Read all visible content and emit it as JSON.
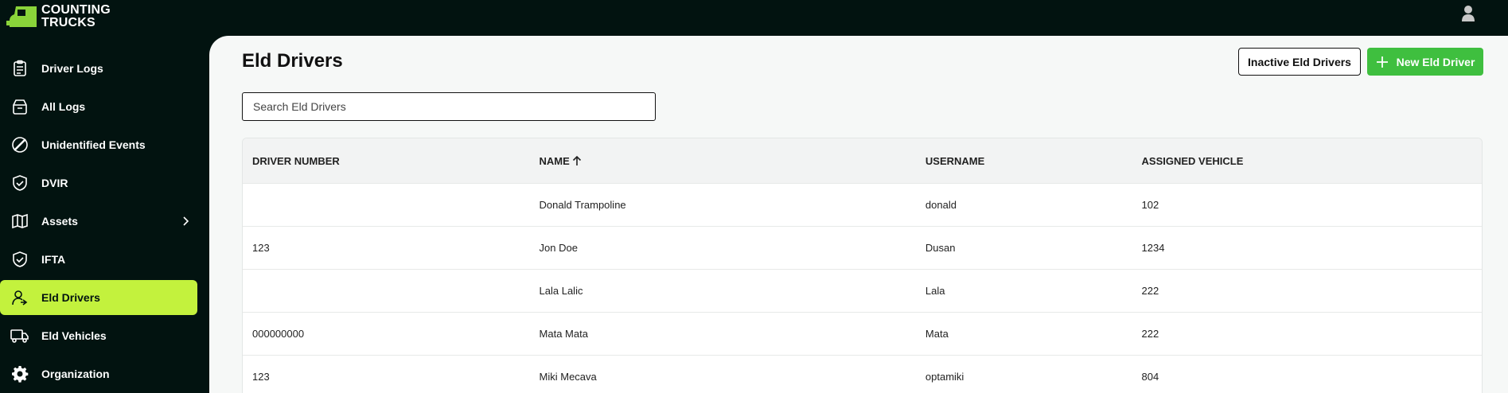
{
  "brand": {
    "line1": "COUNTING",
    "line2": "TRUCKS"
  },
  "sidebar": {
    "items": [
      {
        "label": "Driver Logs",
        "icon": "clipboard-list-icon"
      },
      {
        "label": "All Logs",
        "icon": "archive-box-icon"
      },
      {
        "label": "Unidentified Events",
        "icon": "circle-slash-icon"
      },
      {
        "label": "DVIR",
        "icon": "shield-check-icon"
      },
      {
        "label": "Assets",
        "icon": "map-icon"
      },
      {
        "label": "IFTA",
        "icon": "shield-icon"
      },
      {
        "label": "Eld Drivers",
        "icon": "user-arrow-icon"
      },
      {
        "label": "Eld Vehicles",
        "icon": "truck-icon"
      },
      {
        "label": "Organization",
        "icon": "gear-icon"
      }
    ],
    "active": "Eld Drivers",
    "active_color": "#c3f23d"
  },
  "page": {
    "title": "Eld Drivers"
  },
  "buttons": {
    "inactive": "Inactive Eld Drivers",
    "new": "New Eld Driver",
    "new_color": "#3fbf3f"
  },
  "search": {
    "placeholder": "Search Eld Drivers",
    "value": ""
  },
  "table": {
    "headers": [
      "DRIVER NUMBER",
      "NAME",
      "USERNAME",
      "ASSIGNED VEHICLE"
    ],
    "sorted_by": "NAME",
    "sort_direction": "ascending",
    "rows": [
      {
        "number": "",
        "name": "Donald Trampoline",
        "username": "donald",
        "vehicle": "102"
      },
      {
        "number": "123",
        "name": "Jon Doe",
        "username": "Dusan",
        "vehicle": "1234"
      },
      {
        "number": "",
        "name": "Lala Lalic",
        "username": "Lala",
        "vehicle": "222"
      },
      {
        "number": "000000000",
        "name": "Mata Mata",
        "username": "Mata",
        "vehicle": "222"
      },
      {
        "number": "123",
        "name": "Miki Mecava",
        "username": "optamiki",
        "vehicle": "804"
      }
    ]
  }
}
